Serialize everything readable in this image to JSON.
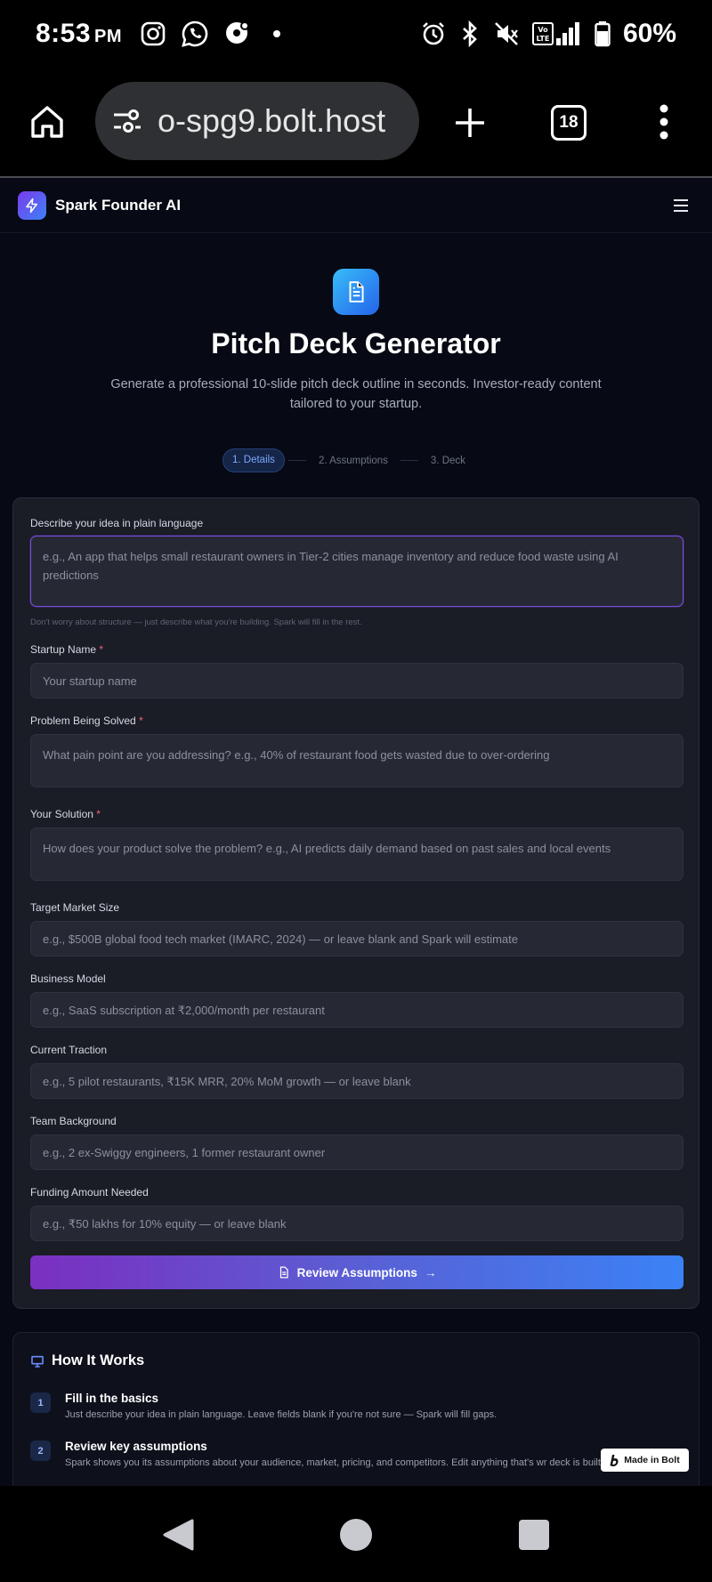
{
  "status_bar": {
    "time": "8:53",
    "ampm": "PM",
    "battery_percent": "60%"
  },
  "browser": {
    "url": "o-spg9.bolt.host",
    "tab_count": "18"
  },
  "app": {
    "brand": "Spark Founder AI"
  },
  "hero": {
    "title": "Pitch Deck Generator",
    "subtitle": "Generate a professional 10-slide pitch deck outline in seconds. Investor-ready content tailored to your startup."
  },
  "steps": [
    {
      "label": "1. Details",
      "active": true
    },
    {
      "label": "2. Assumptions",
      "active": false
    },
    {
      "label": "3. Deck",
      "active": false
    }
  ],
  "form": {
    "idea": {
      "label": "Describe your idea in plain language",
      "placeholder": "e.g., An app that helps small restaurant owners in Tier-2 cities manage inventory and reduce food waste using AI predictions",
      "hint": "Don't worry about structure — just describe what you're building. Spark will fill in the rest."
    },
    "startup_name": {
      "label": "Startup Name",
      "required_mark": "*",
      "placeholder": "Your startup name"
    },
    "problem": {
      "label": "Problem Being Solved",
      "required_mark": "*",
      "placeholder": "What pain point are you addressing? e.g., 40% of restaurant food gets wasted due to over-ordering"
    },
    "solution": {
      "label": "Your Solution",
      "required_mark": "*",
      "placeholder": "How does your product solve the problem? e.g., AI predicts daily demand based on past sales and local events"
    },
    "market_size": {
      "label": "Target Market Size",
      "placeholder": "e.g., $500B global food tech market (IMARC, 2024) — or leave blank and Spark will estimate"
    },
    "business_model": {
      "label": "Business Model",
      "placeholder": "e.g., SaaS subscription at ₹2,000/month per restaurant"
    },
    "traction": {
      "label": "Current Traction",
      "placeholder": "e.g., 5 pilot restaurants, ₹15K MRR, 20% MoM growth — or leave blank"
    },
    "team": {
      "label": "Team Background",
      "placeholder": "e.g., 2 ex-Swiggy engineers, 1 former restaurant owner"
    },
    "funding": {
      "label": "Funding Amount Needed",
      "placeholder": "e.g., ₹50 lakhs for 10% equity — or leave blank"
    },
    "submit_label": "Review Assumptions",
    "submit_arrow": "→"
  },
  "how_it_works": {
    "title": "How It Works",
    "steps": [
      {
        "num": "1",
        "title": "Fill in the basics",
        "text": "Just describe your idea in plain language. Leave fields blank if you're not sure — Spark will fill gaps."
      },
      {
        "num": "2",
        "title": "Review key assumptions",
        "text": "Spark shows you its assumptions about your audience, market, pricing, and competitors. Edit anything that's wr deck is built."
      }
    ]
  },
  "badge": {
    "label": "Made in Bolt"
  },
  "colors": {
    "accent_purple": "#7c4ddc",
    "accent_blue": "#3b82f6",
    "required": "#f06475"
  }
}
